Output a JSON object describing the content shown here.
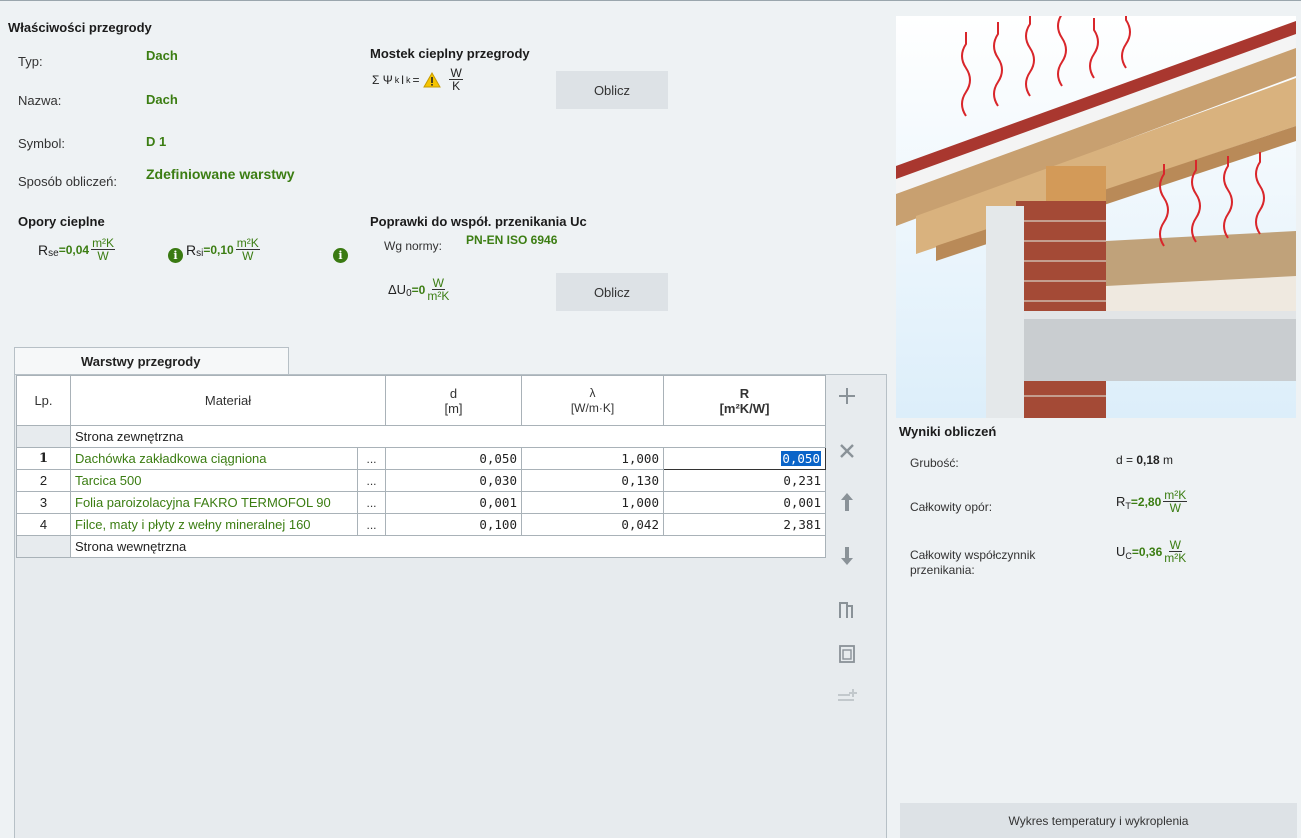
{
  "properties": {
    "title": "Właściwości przegrody",
    "type_label": "Typ:",
    "type_value": "Dach",
    "name_label": "Nazwa:",
    "name_value": "Dach",
    "symbol_label": "Symbol:",
    "symbol_value": "D 1",
    "method_label": "Sposób obliczeń:",
    "method_value": "Zdefiniowane warstwy"
  },
  "thermal_bridge": {
    "title": "Mostek cieplny przegrody",
    "formula_prefix": "Σ Ψ",
    "formula_sub": "k",
    "formula_mid": "l",
    "formula_sub2": "k",
    "formula_eq": "=",
    "unit_num": "W",
    "unit_den": "K",
    "calc_button": "Oblicz"
  },
  "resistances": {
    "title": "Opory cieplne",
    "rse_symbol": "R",
    "rse_sub": "se",
    "rse_value": "=0,04",
    "rsi_symbol": "R",
    "rsi_sub": "si",
    "rsi_value": "=0,10",
    "unit_num": "m²K",
    "unit_den": "W",
    "info": "i"
  },
  "corrections": {
    "title": "Poprawki do współ. przenikania Uc",
    "norm_label": "Wg normy:",
    "norm_value": "PN-EN ISO 6946",
    "du_symbol": "ΔU",
    "du_sub": "0",
    "du_value": "=0",
    "unit_num": "W",
    "unit_den": "m²K",
    "calc_button": "Oblicz"
  },
  "layers": {
    "tab_label": "Warstwy przegrody",
    "columns": {
      "lp": "Lp.",
      "material": "Materiał",
      "d_top": "d",
      "d_unit": "[m]",
      "lambda_top": "λ",
      "lambda_unit": "[W/m·K]",
      "r_top": "R",
      "r_unit": "[m²K/W]"
    },
    "outer_side": "Strona zewnętrzna",
    "inner_side": "Strona wewnętrzna",
    "rows": [
      {
        "lp": "1",
        "material": "Dachówka zakładkowa ciągniona",
        "dots": "...",
        "d": "0,050",
        "lambda": "1,000",
        "r": "0,050"
      },
      {
        "lp": "2",
        "material": "Tarcica 500",
        "dots": "...",
        "d": "0,030",
        "lambda": "0,130",
        "r": "0,231"
      },
      {
        "lp": "3",
        "material": "Folia paroizolacyjna FAKRO TERMOFOL 90",
        "dots": "...",
        "d": "0,001",
        "lambda": "1,000",
        "r": "0,001"
      },
      {
        "lp": "4",
        "material": "Filce, maty i płyty z wełny mineralnej 160",
        "dots": "...",
        "d": "0,100",
        "lambda": "0,042",
        "r": "2,381"
      }
    ]
  },
  "results": {
    "title": "Wyniki obliczeń",
    "thickness_label": "Grubość:",
    "thickness_prefix": "d = ",
    "thickness_value": "0,18",
    "thickness_unit": " m",
    "resistance_label": "Całkowity opór:",
    "rt_symbol": "R",
    "rt_sub": "T",
    "rt_value": "=2,80",
    "rt_unit_num": "m²K",
    "rt_unit_den": "W",
    "u_label_line1": "Całkowity współczynnik",
    "u_label_line2": "przenikania:",
    "u_symbol": "U",
    "u_sub": "C",
    "u_value": "=0,36",
    "u_unit_num": "W",
    "u_unit_den": "m²K",
    "chart_button": "Wykres temperatury i wykroplenia"
  },
  "colors": {
    "accent_green": "#3b7d12",
    "selection_blue": "#0a64c8",
    "background": "#eef2f4"
  }
}
